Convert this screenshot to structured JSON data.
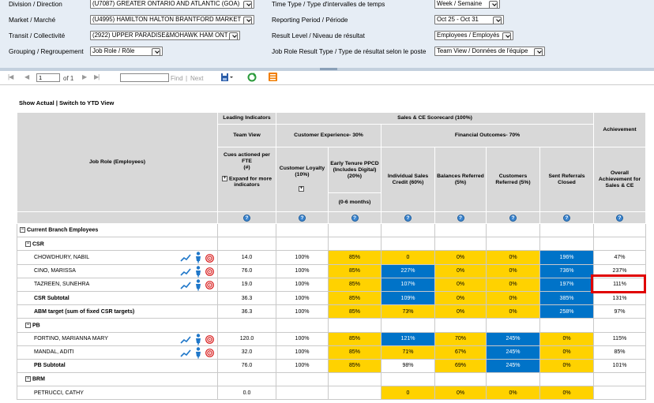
{
  "params": {
    "division_label": "Division / Direction",
    "division_value": "(U7087) GREATER ONTARIO AND ATLANTIC (GOA)",
    "market_label": "Market / Marché",
    "market_value": "(U4995) HAMILTON HALTON BRANTFORD MARKET",
    "transit_label": "Transit / Collectivité",
    "transit_value": "(2922) UPPER PARADISE&MOHAWK HAM ONT",
    "grouping_label": "Grouping / Regroupement",
    "grouping_value": "Job Role / Rôle",
    "time_type_label": "Time Type / Type d'intervalles de temps",
    "time_type_value": "Week / Semaine",
    "period_label": "Reporting Period / Période",
    "period_value": "Oct 25 - Oct 31",
    "result_level_label": "Result Level / Niveau de résultat",
    "result_level_value": "Employees / Employés",
    "result_type_label": "Job Role Result Type / Type de résultat selon le poste",
    "result_type_value": "Team View / Données de l'équipe"
  },
  "toolbar": {
    "page_value": "1",
    "of_label": "of 1",
    "find_label": "Find",
    "separator": "|",
    "next_label": "Next"
  },
  "links": {
    "show_actual": "Show Actual",
    "separator": "|",
    "switch_ytd": "Switch to YTD View"
  },
  "header": {
    "leading": "Leading Indicators",
    "scorecard": "Sales & CE Scorecard (100%)",
    "team_view": "Team View",
    "cx": "Customer Experience- 30%",
    "financial": "Financial Outcomes- 70%",
    "achievement": "Achievement",
    "job_role": "Job Role (Employees)",
    "cues": "Cues actioned per FTE",
    "cues_unit": "(#)",
    "expand": "Expand for more indicators",
    "loyalty": "Customer Loyalty (10%)",
    "early_tenure": "Early Tenure PPCD (Includes Digital) (20%)",
    "months": "(0-6 months)",
    "ind_sales": "Individual Sales Credit (60%)",
    "balances": "Balances Referred (5%)",
    "cust_ref": "Customers Referred (5%)",
    "sent_ref": "Sent Referrals Closed",
    "overall": "Overall Achievement for Sales & CE",
    "help": "?",
    "plus": "+",
    "minus": "−"
  },
  "rows": {
    "cbe": "Current Branch Employees",
    "csr": "CSR",
    "pb": "PB",
    "brm": "BRM",
    "r1": {
      "name": "CHOWDHURY, NABIL",
      "cues": "14.0",
      "loy": "100%",
      "et": "85%",
      "isc": "0",
      "bal": "0%",
      "cr": "0%",
      "src": "196%",
      "ov": "47%"
    },
    "r2": {
      "name": "CINO, MARISSA",
      "cues": "76.0",
      "loy": "100%",
      "et": "85%",
      "isc": "227%",
      "bal": "0%",
      "cr": "0%",
      "src": "736%",
      "ov": "237%"
    },
    "r3": {
      "name": "TAZREEN, SUNEHRA",
      "cues": "19.0",
      "loy": "100%",
      "et": "85%",
      "isc": "107%",
      "bal": "0%",
      "cr": "0%",
      "src": "197%",
      "ov": "111%"
    },
    "r4": {
      "name": "CSR Subtotal",
      "cues": "36.3",
      "loy": "100%",
      "et": "85%",
      "isc": "109%",
      "bal": "0%",
      "cr": "0%",
      "src": "385%",
      "ov": "131%"
    },
    "r5": {
      "name": "ABM target (sum of fixed CSR targets)",
      "cues": "36.3",
      "loy": "100%",
      "et": "85%",
      "isc": "73%",
      "bal": "0%",
      "cr": "0%",
      "src": "258%",
      "ov": "97%"
    },
    "r6": {
      "name": "FORTINO, MARIANNA MARY",
      "cues": "120.0",
      "loy": "100%",
      "et": "85%",
      "isc": "121%",
      "bal": "70%",
      "cr": "245%",
      "src": "0%",
      "ov": "115%"
    },
    "r7": {
      "name": "MANDAL, ADITI",
      "cues": "32.0",
      "loy": "100%",
      "et": "85%",
      "isc": "71%",
      "bal": "67%",
      "cr": "245%",
      "src": "0%",
      "ov": "85%"
    },
    "r8": {
      "name": "PB Subtotal",
      "cues": "76.0",
      "loy": "100%",
      "et": "85%",
      "isc": "98%",
      "bal": "69%",
      "cr": "245%",
      "src": "0%",
      "ov": "101%"
    },
    "r9": {
      "name": "PETRUCCI, CATHY",
      "cues": "0.0",
      "loy": "",
      "et": "",
      "isc": "0",
      "bal": "0%",
      "cr": "0%",
      "src": "0%",
      "ov": ""
    }
  },
  "icons": {
    "trend": "trend-chart-icon",
    "person": "person-icon",
    "target": "target-icon",
    "export": "export-icon",
    "refresh": "refresh-icon",
    "rss": "feed-icon"
  },
  "colors": {
    "yellow": "#ffd200",
    "blue": "#0073c8",
    "highlight": "#e00000"
  }
}
